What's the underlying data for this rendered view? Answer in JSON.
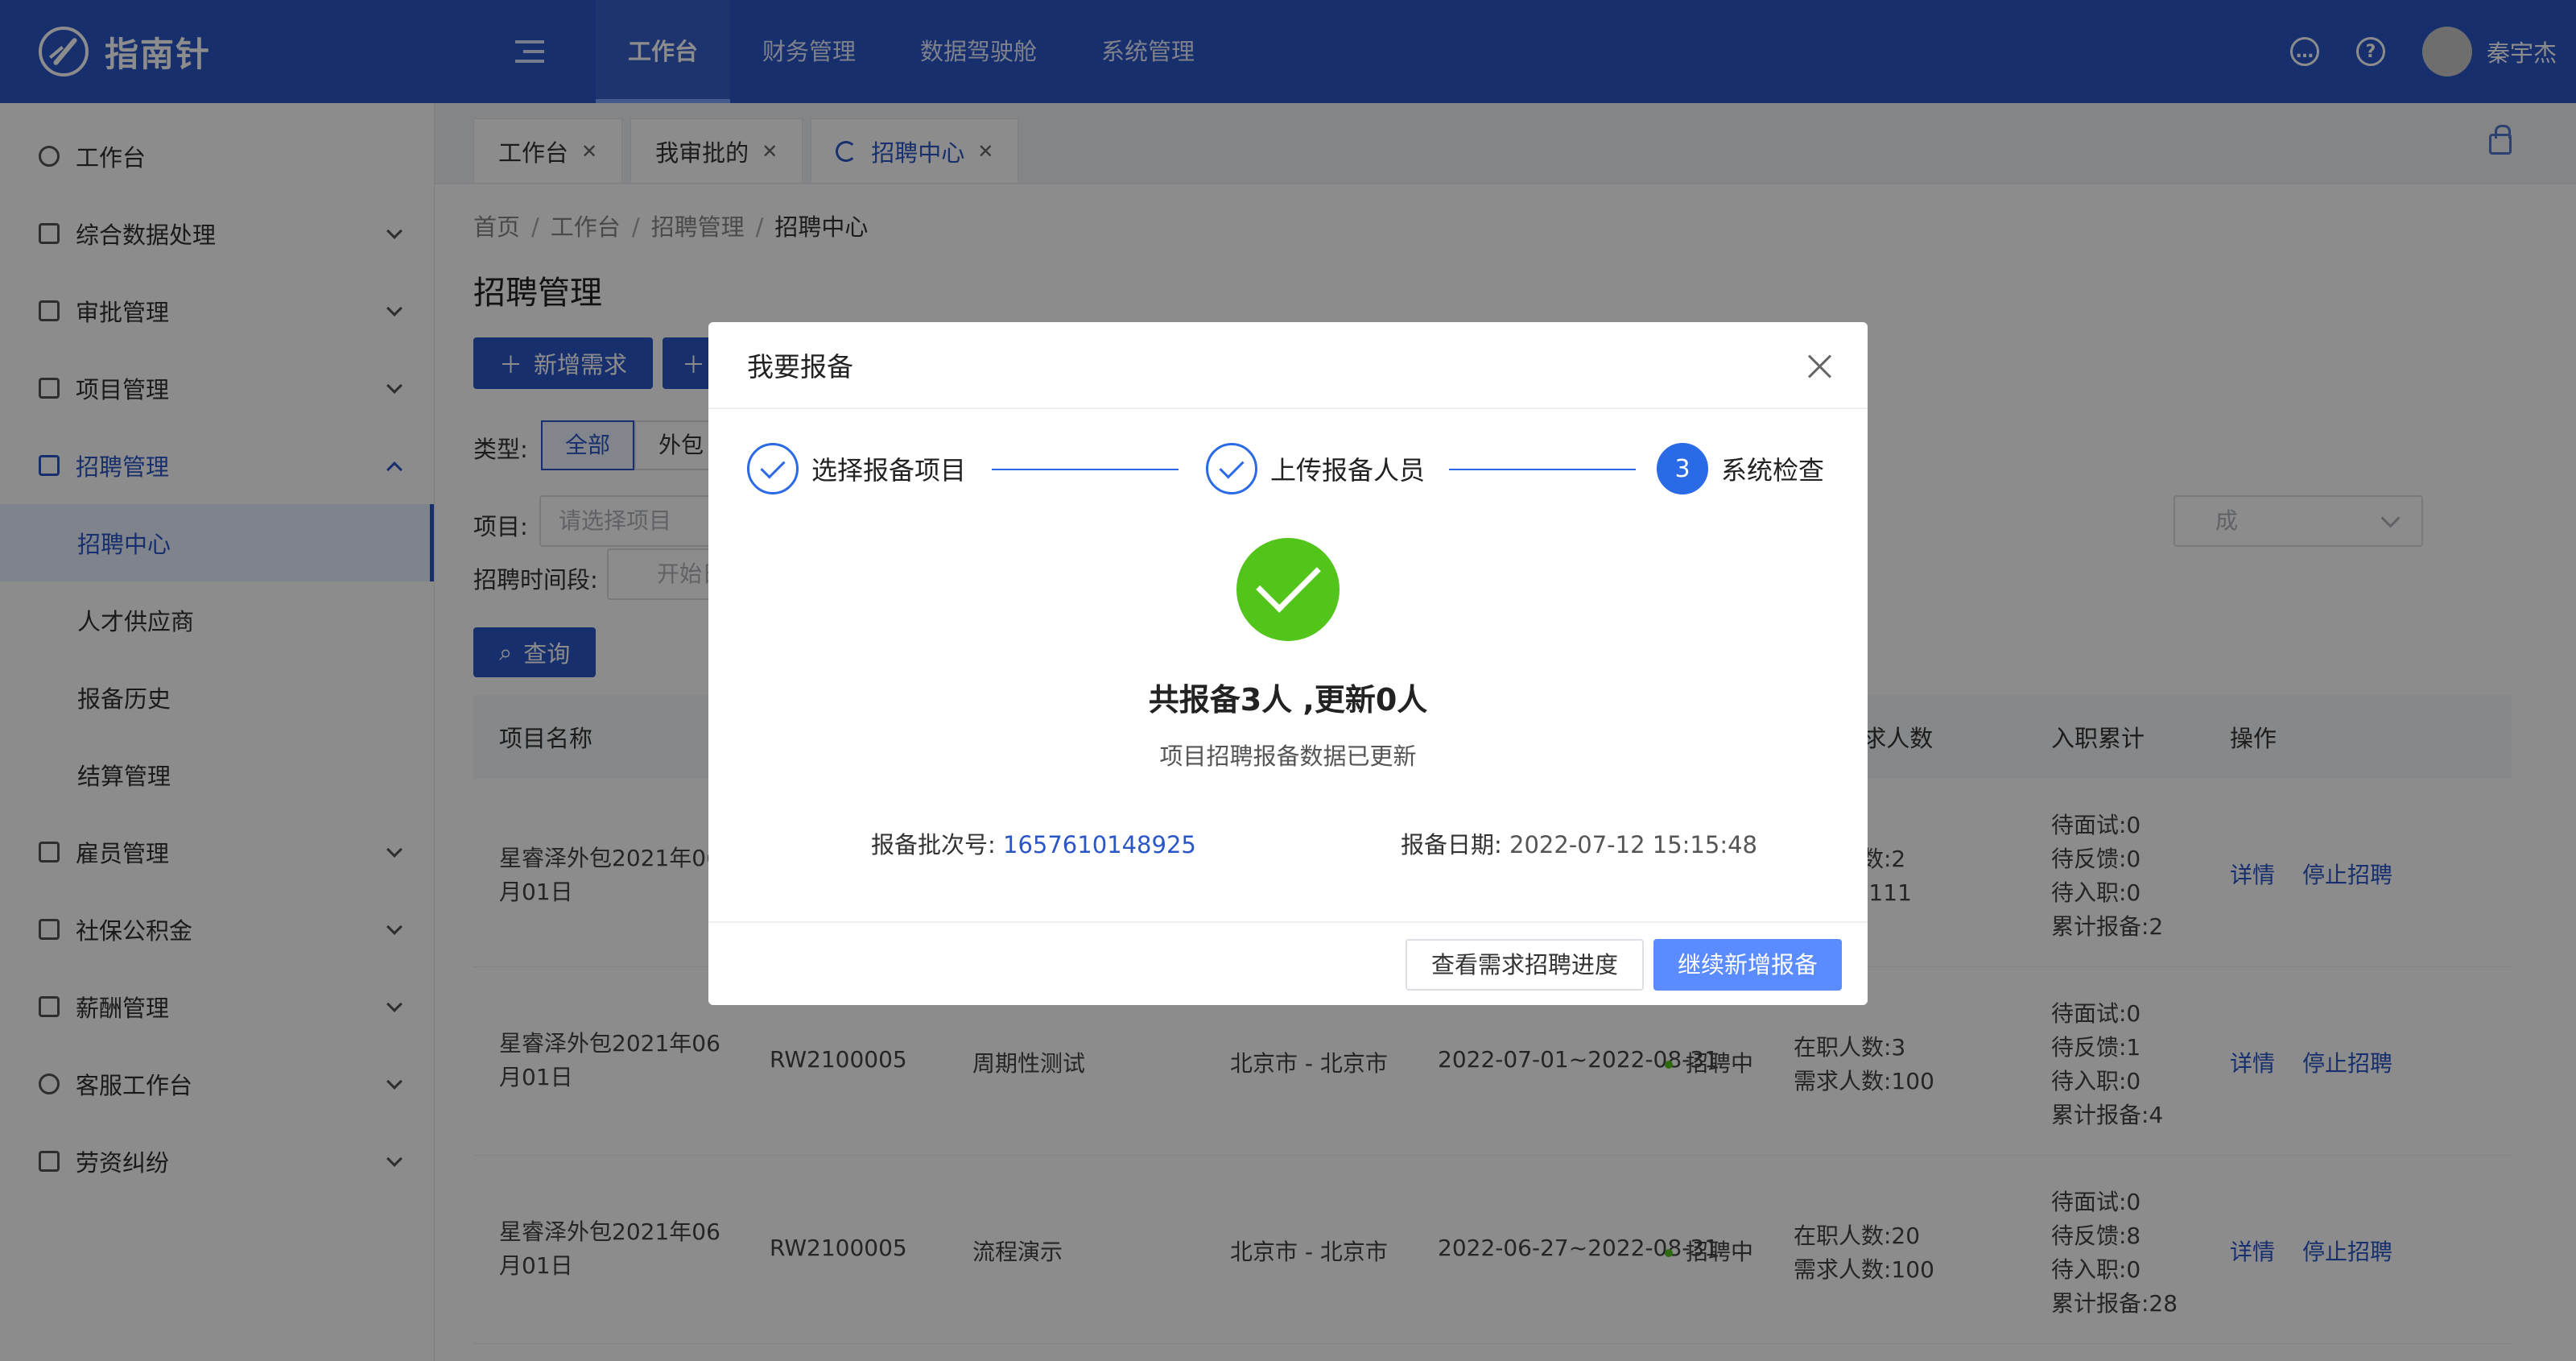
{
  "app": {
    "name": "指南针"
  },
  "top_nav": [
    "工作台",
    "财务管理",
    "数据驾驶舱",
    "系统管理"
  ],
  "user": {
    "name": "秦宇杰"
  },
  "sidebar": {
    "items": [
      {
        "label": "工作台"
      },
      {
        "label": "综合数据处理"
      },
      {
        "label": "审批管理"
      },
      {
        "label": "项目管理"
      },
      {
        "label": "招聘管理",
        "children": [
          "招聘中心",
          "人才供应商",
          "报备历史",
          "结算管理"
        ]
      },
      {
        "label": "雇员管理"
      },
      {
        "label": "社保公积金"
      },
      {
        "label": "薪酬管理"
      },
      {
        "label": "客服工作台"
      },
      {
        "label": "劳资纠纷"
      }
    ]
  },
  "tabs": [
    {
      "label": "工作台"
    },
    {
      "label": "我审批的"
    },
    {
      "label": "招聘中心"
    }
  ],
  "breadcrumb": [
    "首页",
    "工作台",
    "招聘管理",
    "招聘中心"
  ],
  "page": {
    "title": "招聘管理",
    "add_button": "新增需求",
    "type_label": "类型:",
    "type_options": [
      "全部",
      "外包"
    ],
    "project_label": "项目:",
    "project_placeholder": "请选择项目",
    "period_label": "招聘时间段:",
    "period_placeholder": "开始日",
    "select_right_placeholder": "成",
    "query_button": "查询"
  },
  "table": {
    "headers": {
      "name": "项目名称",
      "count": "职 | 需求人数",
      "cumulative": "入职累计",
      "ops": "操作"
    },
    "rows": [
      {
        "name": "星睿泽外包2021年06月01日",
        "code": "",
        "desc": "",
        "city": "",
        "period": "",
        "status": "",
        "onjob": "在职人数:2",
        "need": "求人数:111",
        "c1": "待面试:0",
        "c2": "待反馈:0",
        "c3": "待入职:0",
        "c4": "累计报备:2"
      },
      {
        "name": "星睿泽外包2021年06月01日",
        "code": "RW2100005",
        "desc": "周期性测试",
        "city": "北京市 - 北京市",
        "period": "2022-07-01~2022-08-31",
        "status": "招聘中",
        "onjob": "在职人数:3",
        "need": "需求人数:100",
        "c1": "待面试:0",
        "c2": "待反馈:1",
        "c3": "待入职:0",
        "c4": "累计报备:4"
      },
      {
        "name": "星睿泽外包2021年06月01日",
        "code": "RW2100005",
        "desc": "流程演示",
        "city": "北京市 - 北京市",
        "period": "2022-06-27~2022-08-31",
        "status": "招聘中",
        "onjob": "在职人数:20",
        "need": "需求人数:100",
        "c1": "待面试:0",
        "c2": "待反馈:8",
        "c3": "待入职:0",
        "c4": "累计报备:28"
      }
    ],
    "op_detail": "详情",
    "op_stop": "停止招聘"
  },
  "modal": {
    "title": "我要报备",
    "steps": [
      "选择报备项目",
      "上传报备人员",
      "系统检查"
    ],
    "step3_num": "3",
    "result_title": "共报备3人 ,更新0人",
    "result_sub": "项目招聘报备数据已更新",
    "batch_label": "报备批次号:",
    "batch_value": "1657610148925",
    "date_label": "报备日期:",
    "date_value": "2022-07-12 15:15:48",
    "btn_view": "查看需求招聘进度",
    "btn_continue": "继续新增报备"
  },
  "colors": {
    "primary": "#2b56c6",
    "success": "#52c41a",
    "step": "#2b6ae6"
  }
}
